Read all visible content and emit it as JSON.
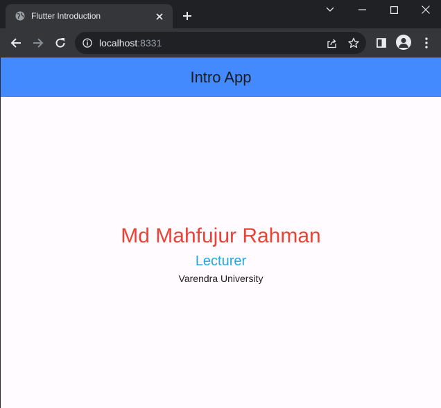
{
  "browser": {
    "tab": {
      "title": "Flutter Introduction",
      "favicon": "globe-icon"
    },
    "window_controls": [
      "chevron-down-icon",
      "minimize-icon",
      "maximize-icon",
      "close-icon"
    ],
    "address_bar": {
      "host": "localhost",
      "port": ":8331"
    }
  },
  "app": {
    "appbar_title": "Intro App",
    "appbar_color": "#448aff",
    "name": "Md Mahfujur Rahman",
    "name_color": "#ea4335",
    "role": "Lecturer",
    "role_color": "#1ea8e6",
    "organization": "Varendra University",
    "background_color": "#fffbfe"
  }
}
